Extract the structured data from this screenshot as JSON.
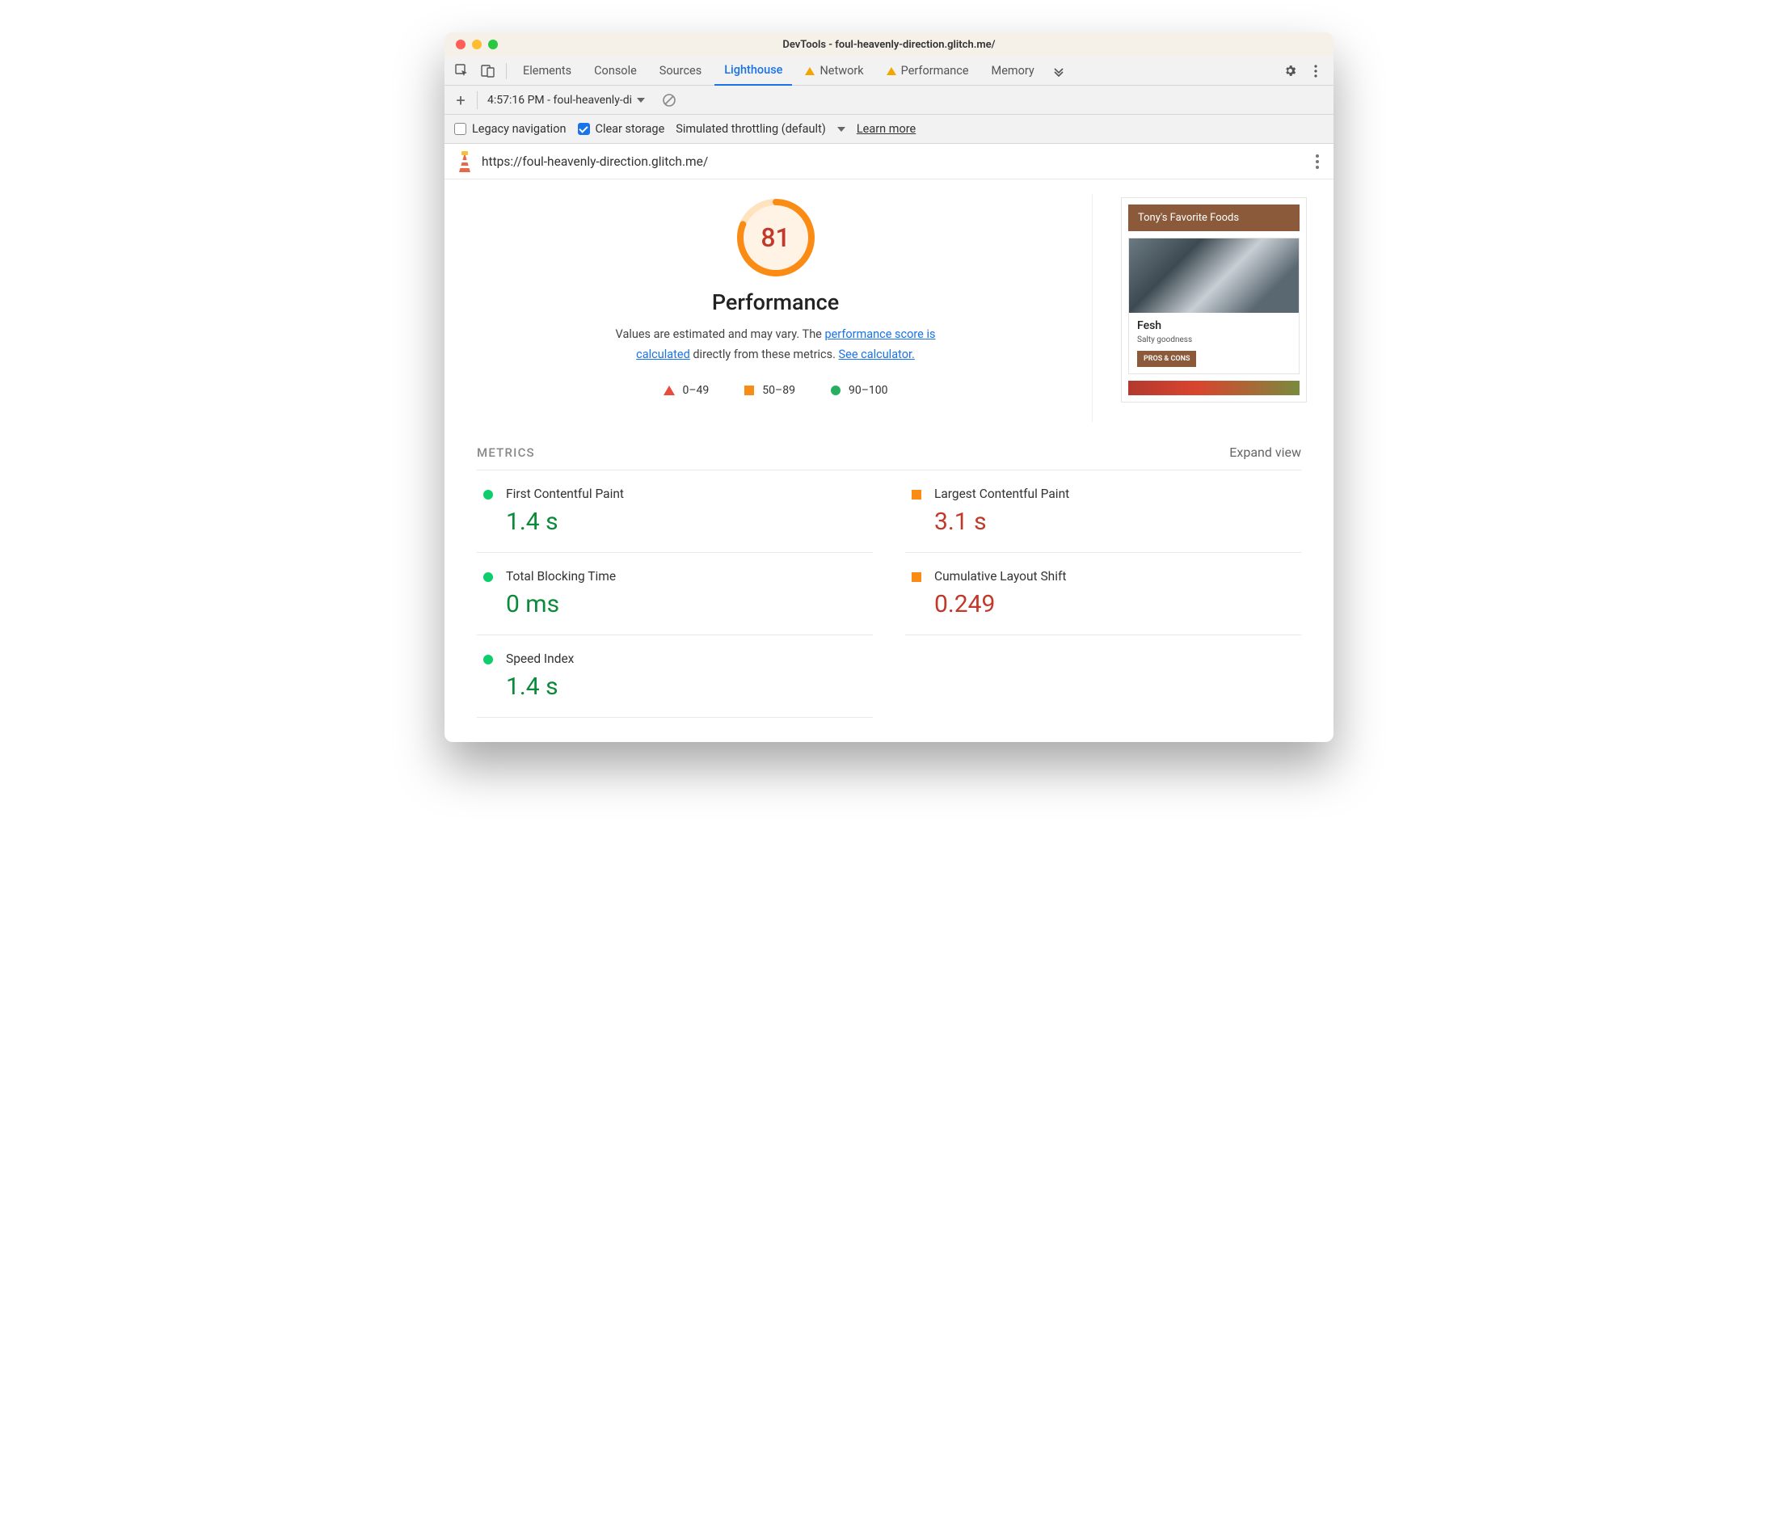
{
  "window": {
    "title": "DevTools - foul-heavenly-direction.glitch.me/"
  },
  "tabs": {
    "elements": "Elements",
    "console": "Console",
    "sources": "Sources",
    "lighthouse": "Lighthouse",
    "network": "Network",
    "performance": "Performance",
    "memory": "Memory"
  },
  "toolbar": {
    "report_selector": "4:57:16 PM - foul-heavenly-di"
  },
  "settings": {
    "legacy_nav_label": "Legacy navigation",
    "legacy_nav_checked": false,
    "clear_storage_label": "Clear storage",
    "clear_storage_checked": true,
    "throttling_label": "Simulated throttling (default)",
    "learn_more": "Learn more"
  },
  "report": {
    "url": "https://foul-heavenly-direction.glitch.me/",
    "score": "81",
    "category": "Performance",
    "desc_prefix": "Values are estimated and may vary. The ",
    "desc_link1": "performance score is calculated",
    "desc_mid": " directly from these metrics. ",
    "desc_link2": "See calculator.",
    "legend": {
      "fail": "0–49",
      "avg": "50–89",
      "pass": "90–100"
    }
  },
  "preview": {
    "title": "Tony's Favorite Foods",
    "card_title": "Fesh",
    "card_sub": "Salty goodness",
    "btn": "PROS & CONS"
  },
  "metrics": {
    "heading": "METRICS",
    "expand": "Expand view",
    "items": [
      {
        "name": "First Contentful Paint",
        "value": "1.4 s",
        "status": "pass"
      },
      {
        "name": "Largest Contentful Paint",
        "value": "3.1 s",
        "status": "avg"
      },
      {
        "name": "Total Blocking Time",
        "value": "0 ms",
        "status": "pass"
      },
      {
        "name": "Cumulative Layout Shift",
        "value": "0.249",
        "status": "avg"
      },
      {
        "name": "Speed Index",
        "value": "1.4 s",
        "status": "pass"
      }
    ]
  }
}
